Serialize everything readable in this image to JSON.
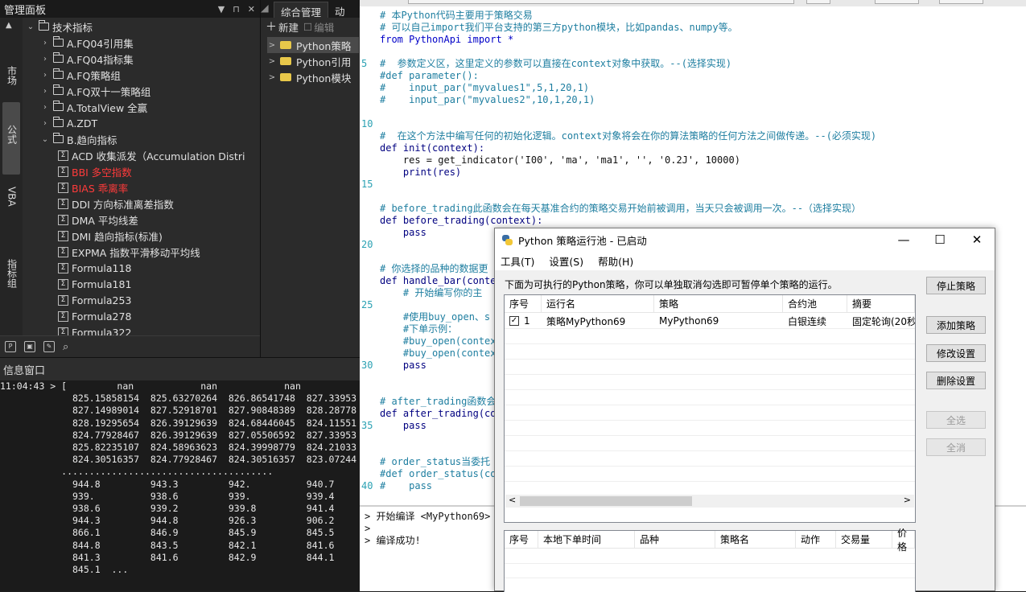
{
  "left_panel": {
    "title": "管理面板",
    "controls": [
      "▼",
      "⊓",
      "✕"
    ],
    "vtabs": [
      "市场",
      "公式",
      "VBA",
      "指标组"
    ],
    "tree": [
      {
        "label": "技术指标",
        "arrow": "v",
        "type": "folder",
        "indent": 0
      },
      {
        "label": "A.FQ04引用集",
        "arrow": ">",
        "type": "folder",
        "indent": 1
      },
      {
        "label": "A.FQ04指标集",
        "arrow": ">",
        "type": "folder",
        "indent": 1
      },
      {
        "label": "A.FQ策略组",
        "arrow": ">",
        "type": "folder",
        "indent": 1
      },
      {
        "label": "A.FQ双十一策略组",
        "arrow": ">",
        "type": "folder",
        "indent": 1
      },
      {
        "label": "A.TotalView 全赢",
        "arrow": ">",
        "type": "folder",
        "indent": 1
      },
      {
        "label": "A.ZDT",
        "arrow": ">",
        "type": "folder",
        "indent": 1
      },
      {
        "label": "B.趋向指标",
        "arrow": "v",
        "type": "folder",
        "indent": 1
      },
      {
        "label": "ACD 收集派发（Accumulation Distri",
        "type": "formula",
        "indent": 2
      },
      {
        "label": "BBI 多空指数",
        "type": "formula",
        "indent": 2,
        "red": true
      },
      {
        "label": "BIAS 乖离率",
        "type": "formula",
        "indent": 2,
        "red": true
      },
      {
        "label": "DDI 方向标准离差指数",
        "type": "formula",
        "indent": 2
      },
      {
        "label": "DMA 平均线差",
        "type": "formula",
        "indent": 2
      },
      {
        "label": "DMI 趋向指标(标准)",
        "type": "formula",
        "indent": 2
      },
      {
        "label": "EXPMA 指数平滑移动平均线",
        "type": "formula",
        "indent": 2
      },
      {
        "label": "Formula118",
        "type": "formula",
        "indent": 2
      },
      {
        "label": "Formula181",
        "type": "formula",
        "indent": 2
      },
      {
        "label": "Formula253",
        "type": "formula",
        "indent": 2
      },
      {
        "label": "Formula278",
        "type": "formula",
        "indent": 2
      },
      {
        "label": "Formula322",
        "type": "formula",
        "indent": 2
      }
    ]
  },
  "mid_panel": {
    "tabs": [
      "综合管理",
      "动"
    ],
    "new_label": "新建",
    "edit_label": "编辑",
    "items": [
      "Python策略",
      "Python引用",
      "Python模块"
    ]
  },
  "info": {
    "title": "信息窗口",
    "lines": [
      "11:04:43 > [         nan            nan            nan",
      "             825.15858154  825.63270264  826.86541748  827.33953",
      "             827.14989014  827.52918701  827.90848389  828.28778",
      "             828.19295654  826.39129639  824.68446045  824.11551",
      "             824.77928467  826.39129639  827.05506592  827.33953",
      "             825.82235107  824.58963623  824.39998779  824.21033",
      "             824.30516357  824.77928467  824.30516357  823.07244",
      "           ......................................",
      "             944.8         943.3         942.          940.7",
      "             939.          938.6         939.          939.4",
      "             938.6         939.2         939.8         941.4",
      "             944.3         944.8         926.3         906.2",
      "             866.1         846.9         845.9         845.5",
      "             844.8         843.5         842.1         841.6",
      "             841.3         841.6         842.9         844.1",
      "             845.1  ..."
    ]
  },
  "editor": {
    "line_numbers": [
      {
        "n": "5",
        "row": 5
      },
      {
        "n": "10",
        "row": 10
      },
      {
        "n": "15",
        "row": 15
      },
      {
        "n": "20",
        "row": 20
      },
      {
        "n": "25",
        "row": 25
      },
      {
        "n": "30",
        "row": 30
      },
      {
        "n": "35",
        "row": 35
      },
      {
        "n": "40",
        "row": 40
      }
    ],
    "code": [
      {
        "t": "# 本Python代码主要用于策略交易",
        "c": "c"
      },
      {
        "t": "# 可以自己import我们平台支持的第三方python模块，比如pandas、numpy等。",
        "c": "c"
      },
      {
        "t": "from PythonApi import *",
        "c": "k"
      },
      {
        "t": "",
        "c": ""
      },
      {
        "t": "#  参数定义区，这里定义的参数可以直接在context对象中获取。--(选择实现)",
        "c": "c"
      },
      {
        "t": "#def parameter():",
        "c": "c"
      },
      {
        "t": "#    input_par(\"myvalues1\",5,1,20,1)",
        "c": "c"
      },
      {
        "t": "#    input_par(\"myvalues2\",10,1,20,1)",
        "c": "c"
      },
      {
        "t": "",
        "c": ""
      },
      {
        "t": "",
        "c": ""
      },
      {
        "t": "#  在这个方法中编写任何的初始化逻辑。context对象将会在你的算法策略的任何方法之间做传递。--(必须实现)",
        "c": "c"
      },
      {
        "t": "def init(context):",
        "c": "f"
      },
      {
        "t": "    res = get_indicator('I00', 'ma', 'ma1', '', '0.2J', 10000)",
        "c": ""
      },
      {
        "t": "    print(res)",
        "c": "f"
      },
      {
        "t": "",
        "c": ""
      },
      {
        "t": "",
        "c": ""
      },
      {
        "t": "# before_trading此函数会在每天基准合约的策略交易开始前被调用，当天只会被调用一次。--（选择实现）",
        "c": "c"
      },
      {
        "t": "def before_trading(context):",
        "c": "f"
      },
      {
        "t": "    pass",
        "c": "f"
      },
      {
        "t": "",
        "c": ""
      },
      {
        "t": "",
        "c": ""
      },
      {
        "t": "# 你选择的品种的数据更",
        "c": "c"
      },
      {
        "t": "def handle_bar(conte",
        "c": "f"
      },
      {
        "t": "    # 开始编写你的主",
        "c": "c"
      },
      {
        "t": "",
        "c": ""
      },
      {
        "t": "    #使用buy_open、s",
        "c": "c"
      },
      {
        "t": "    #下单示例：",
        "c": "c"
      },
      {
        "t": "    #buy_open(contex",
        "c": "c"
      },
      {
        "t": "    #buy_open(contex",
        "c": "c"
      },
      {
        "t": "    pass",
        "c": "f"
      },
      {
        "t": "",
        "c": ""
      },
      {
        "t": "",
        "c": ""
      },
      {
        "t": "# after_trading函数会",
        "c": "c"
      },
      {
        "t": "def after_trading(co",
        "c": "f"
      },
      {
        "t": "    pass",
        "c": "f"
      },
      {
        "t": "",
        "c": ""
      },
      {
        "t": "",
        "c": ""
      },
      {
        "t": "# order_status当委托",
        "c": "c"
      },
      {
        "t": "#def order_status(co",
        "c": "c"
      },
      {
        "t": "#    pass",
        "c": "c"
      }
    ],
    "console": [
      "> 开始编译 <MyPython69> ...",
      "> ",
      "",
      "> 编译成功!"
    ]
  },
  "dialog": {
    "title": "Python 策略运行池 - 已启动",
    "win_controls": [
      "—",
      "☐",
      "✕"
    ],
    "menus": [
      "工具(T)",
      "设置(S)",
      "帮助(H)"
    ],
    "description": "下面为可执行的Python策略，你可以单独取消勾选即可暂停单个策略的运行。",
    "table1": {
      "headers": [
        "序号",
        "运行名",
        "策略",
        "合约池",
        "摘要"
      ],
      "rows": [
        {
          "checked": "✓",
          "no": "1",
          "run_name": "策略MyPython69",
          "strategy": "MyPython69",
          "pool": "白银连续",
          "summary": "固定轮询(20秒"
        }
      ]
    },
    "table2": {
      "headers": [
        "序号",
        "本地下单时间",
        "品种",
        "策略名",
        "动作",
        "交易量",
        "价格"
      ]
    },
    "buttons": {
      "stop": "停止策略",
      "add": "添加策略",
      "modify": "修改设置",
      "delete": "删除设置",
      "select_all": "全选",
      "deselect_all": "全消"
    },
    "scroll": {
      "left": "<",
      "right": ">"
    }
  }
}
